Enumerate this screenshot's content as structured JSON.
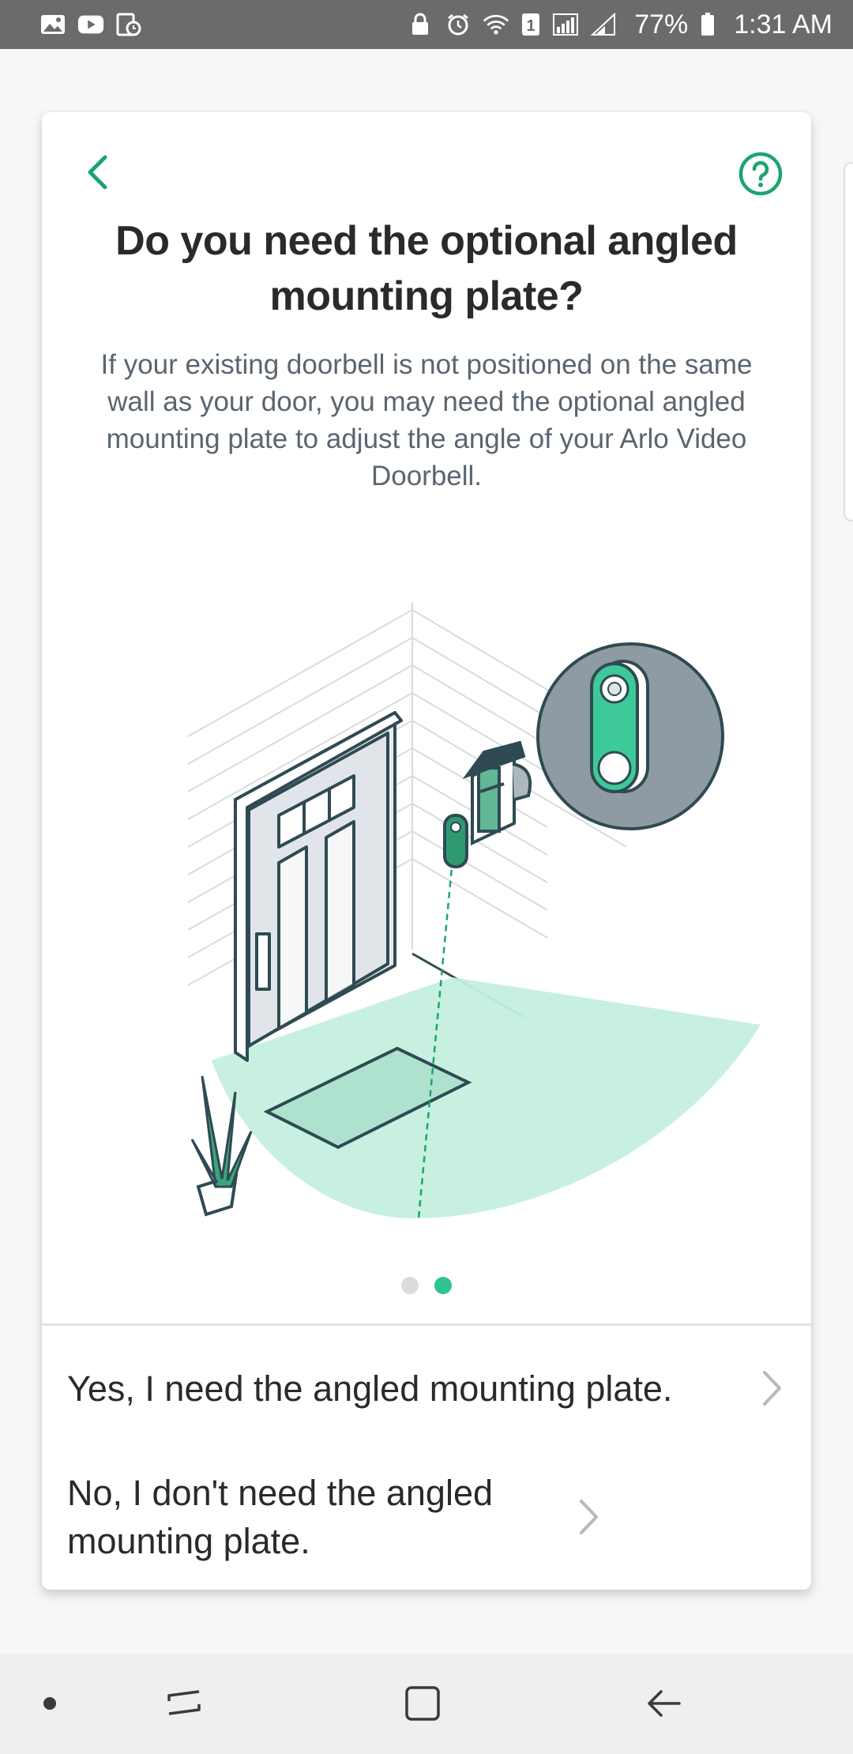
{
  "status_bar": {
    "left_icons": [
      "image-icon",
      "youtube-icon",
      "clock-app-icon"
    ],
    "right_icons": [
      "lock-icon",
      "alarm-icon",
      "wifi-icon",
      "sim-icon",
      "signal-icon",
      "signal-2-icon",
      "battery-icon"
    ],
    "sim_label": "1",
    "battery": "77%",
    "time": "1:31 AM"
  },
  "header": {
    "back_icon": "chevron-left-icon",
    "help_icon": "help-circle-icon",
    "title": "Do you need the optional angled mounting plate?",
    "description": "If your existing doorbell is not positioned on the same wall as your door, you may need the optional angled mounting plate to adjust the angle of your Arlo Video Doorbell."
  },
  "pagination": {
    "total": 2,
    "active": 2
  },
  "options": [
    {
      "label": "Yes, I need the angled mounting plate."
    },
    {
      "label": "No, I don't need the angled mounting plate."
    }
  ],
  "colors": {
    "accent": "#1aa56e",
    "accent_light": "#c4efdf",
    "dark_line": "#2f4a52",
    "dot_active": "#2fc48f"
  }
}
